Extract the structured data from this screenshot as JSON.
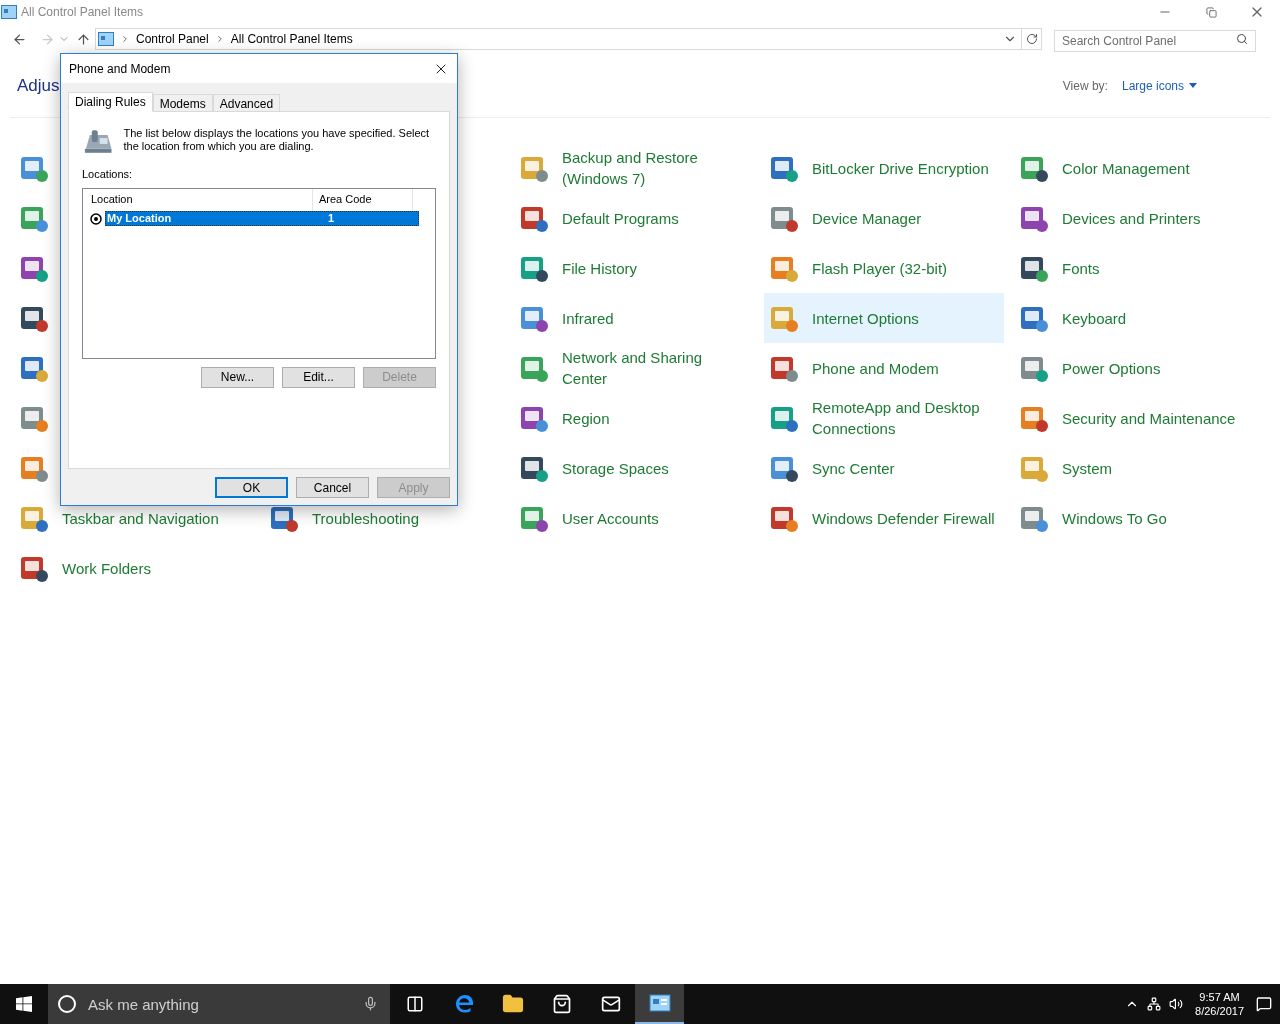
{
  "window": {
    "title": "All Control Panel Items"
  },
  "address": {
    "crumbs": [
      "Control Panel",
      "All Control Panel Items"
    ]
  },
  "search": {
    "placeholder": "Search Control Panel"
  },
  "heading": "Adjus",
  "view_by": {
    "label": "View by:",
    "value": "Large icons"
  },
  "grid": [
    [
      {
        "kind": "icon-only"
      },
      {
        "kind": "item",
        "label": "Backup and Restore (Windows 7)",
        "selected": false
      },
      {
        "kind": "item",
        "label": "BitLocker Drive Encryption",
        "selected": false
      },
      {
        "kind": "item",
        "label": "Color Management",
        "selected": false
      }
    ],
    [
      {
        "kind": "icon-only"
      },
      {
        "kind": "item",
        "label": "Default Programs",
        "selected": false
      },
      {
        "kind": "item",
        "label": "Device Manager",
        "selected": false
      },
      {
        "kind": "item",
        "label": "Devices and Printers",
        "selected": false
      }
    ],
    [
      {
        "kind": "icon-only"
      },
      {
        "kind": "item",
        "label": "File History",
        "selected": false
      },
      {
        "kind": "item",
        "label": "Flash Player (32-bit)",
        "selected": false
      },
      {
        "kind": "item",
        "label": "Fonts",
        "selected": false
      }
    ],
    [
      {
        "kind": "icon-only"
      },
      {
        "kind": "item",
        "label": "Infrared",
        "selected": false
      },
      {
        "kind": "item",
        "label": "Internet Options",
        "selected": true
      },
      {
        "kind": "item",
        "label": "Keyboard",
        "selected": false
      }
    ],
    [
      {
        "kind": "icon-only"
      },
      {
        "kind": "item",
        "label": "Network and Sharing Center",
        "selected": false
      },
      {
        "kind": "item",
        "label": "Phone and Modem",
        "selected": false
      },
      {
        "kind": "item",
        "label": "Power Options",
        "selected": false
      }
    ],
    [
      {
        "kind": "icon-only"
      },
      {
        "kind": "item",
        "label": "Region",
        "selected": false
      },
      {
        "kind": "item",
        "label": "RemoteApp and Desktop Connections",
        "selected": false
      },
      {
        "kind": "item",
        "label": "Security and Maintenance",
        "selected": false
      }
    ],
    [
      {
        "kind": "icon-only"
      },
      {
        "kind": "item",
        "label": "Storage Spaces",
        "selected": false
      },
      {
        "kind": "item",
        "label": "Sync Center",
        "selected": false
      },
      {
        "kind": "item",
        "label": "System",
        "selected": false
      }
    ],
    [
      {
        "kind": "item",
        "label": "Taskbar and Navigation",
        "selected": false
      },
      {
        "kind": "item",
        "label": "Troubleshooting",
        "selected": false
      },
      {
        "kind": "item",
        "label": "User Accounts",
        "selected": false
      },
      {
        "kind": "item",
        "label": "Windows Defender Firewall",
        "selected": false
      },
      {
        "kind": "item",
        "label": "Windows To Go",
        "selected": false
      }
    ],
    [
      {
        "kind": "item",
        "label": "Work Folders",
        "selected": false
      }
    ]
  ],
  "dialog": {
    "title": "Phone and Modem",
    "tabs": [
      {
        "label": "Dialing Rules",
        "selected": true
      },
      {
        "label": "Modems",
        "selected": false
      },
      {
        "label": "Advanced",
        "selected": false
      }
    ],
    "description": "The list below displays the locations you have specified. Select the location from which you are dialing.",
    "list_label": "Locations:",
    "columns": [
      "Location",
      "Area Code"
    ],
    "rows": [
      {
        "location": "My Location",
        "area_code": "1",
        "selected": true,
        "current": true
      }
    ],
    "row_buttons": [
      {
        "label": "New...",
        "disabled": false
      },
      {
        "label": "Edit...",
        "disabled": false
      },
      {
        "label": "Delete",
        "disabled": true
      }
    ],
    "footer_buttons": [
      {
        "label": "OK",
        "default": true,
        "disabled": false
      },
      {
        "label": "Cancel",
        "default": false,
        "disabled": false
      },
      {
        "label": "Apply",
        "default": false,
        "disabled": true
      }
    ]
  },
  "taskbar": {
    "search_placeholder": "Ask me anything",
    "apps": [
      {
        "kind": "task-view",
        "selected": false
      },
      {
        "kind": "browser",
        "selected": false
      },
      {
        "kind": "folder",
        "selected": false
      },
      {
        "kind": "store",
        "selected": false
      },
      {
        "kind": "mail",
        "selected": false
      },
      {
        "kind": "control-panel",
        "selected": true
      }
    ],
    "time": "9:57 AM",
    "date": "8/26/2017"
  }
}
